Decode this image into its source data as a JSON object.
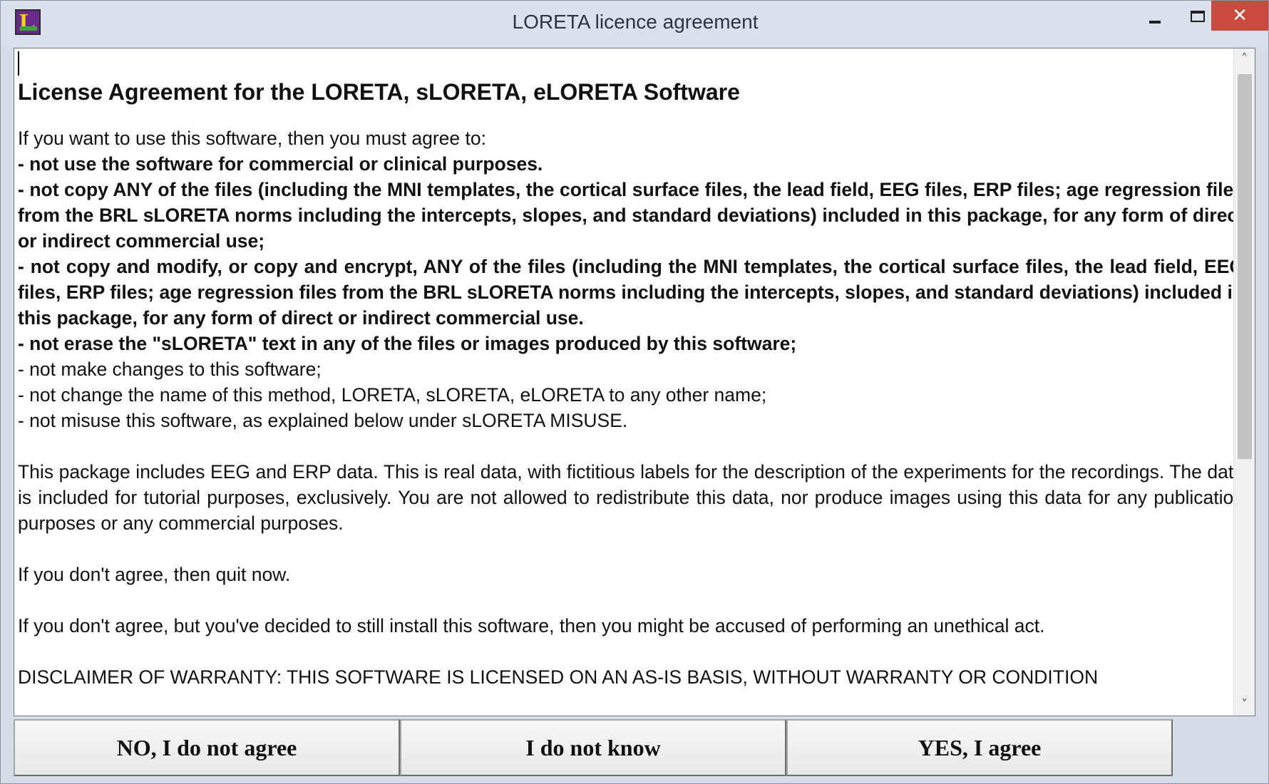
{
  "window": {
    "title": "LORETA licence agreement",
    "icon_letter": "L",
    "controls": {
      "minimize": "minimize-icon",
      "maximize": "maximize-icon",
      "close_glyph": "✕"
    }
  },
  "license": {
    "heading": "License Agreement for the LORETA, sLORETA, eLORETA Software",
    "intro": "If you want to use this software, then you must agree to:",
    "conditions_bold": [
      "- not use the software for commercial or clinical purposes.",
      "- not copy ANY of the files (including the MNI templates, the cortical surface files, the lead field, EEG files, ERP files; age regression files from the BRL sLORETA norms including the intercepts, slopes, and standard deviations) included in this package, for any form of direct or indirect commercial use;",
      "- not copy and modify, or copy and encrypt, ANY of the files (including the MNI templates, the cortical surface files, the lead field, EEG files, ERP files; age regression files from the BRL sLORETA norms including the intercepts, slopes, and standard deviations) included in this package, for any form of direct or indirect commercial use.",
      "- not erase the \"sLORETA\" text in any of the files or images produced by this software;"
    ],
    "conditions_regular": [
      "- not make changes to this software;",
      "- not change the name of this method, LORETA, sLORETA, eLORETA to any other name;",
      "- not misuse this software, as explained below under sLORETA MISUSE."
    ],
    "data_note": "This package includes EEG and ERP data. This is real data, with fictitious labels for the description of the experiments for the recordings. The data is included for tutorial purposes, exclusively. You are not allowed to redistribute this data, nor produce images using this data for any publication purposes or any commercial purposes.",
    "quit_note": "If you don't agree, then quit now.",
    "unethical_note": "If you don't agree, but you've decided to still install this software, then you might be accused of performing an unethical act.",
    "disclaimer": "DISCLAIMER OF WARRANTY: THIS SOFTWARE IS LICENSED ON AN AS-IS BASIS, WITHOUT WARRANTY OR CONDITION"
  },
  "scrollbar": {
    "up_glyph": "˄",
    "down_glyph": "˅"
  },
  "buttons": {
    "no": "NO, I do not agree",
    "unknown": "I do not know",
    "yes": "YES, I agree"
  }
}
